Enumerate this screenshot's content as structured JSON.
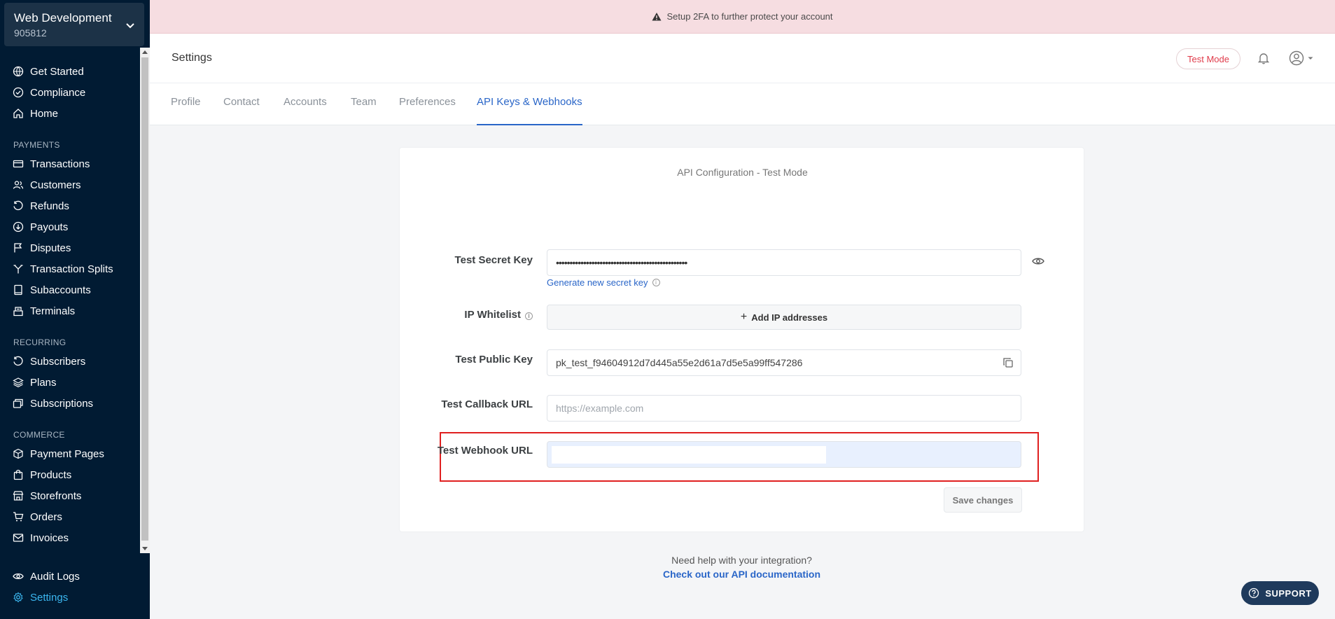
{
  "sidebar": {
    "business_name": "Web Development",
    "business_id": "905812",
    "top_items": [
      {
        "label": "Get Started",
        "icon": "globe-icon"
      },
      {
        "label": "Compliance",
        "icon": "check-circle-icon"
      },
      {
        "label": "Home",
        "icon": "home-icon"
      }
    ],
    "payments_title": "PAYMENTS",
    "payments_items": [
      {
        "label": "Transactions",
        "icon": "card-icon"
      },
      {
        "label": "Customers",
        "icon": "users-icon"
      },
      {
        "label": "Refunds",
        "icon": "refund-icon"
      },
      {
        "label": "Payouts",
        "icon": "payout-icon"
      },
      {
        "label": "Disputes",
        "icon": "flag-icon"
      },
      {
        "label": "Transaction Splits",
        "icon": "split-icon"
      },
      {
        "label": "Subaccounts",
        "icon": "book-icon"
      },
      {
        "label": "Terminals",
        "icon": "terminal-icon"
      }
    ],
    "recurring_title": "RECURRING",
    "recurring_items": [
      {
        "label": "Subscribers",
        "icon": "refresh-icon"
      },
      {
        "label": "Plans",
        "icon": "layers-icon"
      },
      {
        "label": "Subscriptions",
        "icon": "stack-icon"
      }
    ],
    "commerce_title": "COMMERCE",
    "commerce_items": [
      {
        "label": "Payment Pages",
        "icon": "box-icon"
      },
      {
        "label": "Products",
        "icon": "bag-icon"
      },
      {
        "label": "Storefronts",
        "icon": "store-icon"
      },
      {
        "label": "Orders",
        "icon": "cart-icon"
      },
      {
        "label": "Invoices",
        "icon": "mail-icon"
      }
    ],
    "bottom_items": [
      {
        "label": "Audit Logs",
        "icon": "eye-icon"
      },
      {
        "label": "Settings",
        "icon": "gear-icon"
      }
    ],
    "active_color": "#3bb7f0"
  },
  "banner": {
    "text": "Setup 2FA to further protect your account"
  },
  "header": {
    "title": "Settings",
    "test_mode_label": "Test Mode"
  },
  "tabs": [
    {
      "label": "Profile"
    },
    {
      "label": "Contact"
    },
    {
      "label": "Accounts"
    },
    {
      "label": "Team"
    },
    {
      "label": "Preferences"
    },
    {
      "label": "API Keys & Webhooks"
    }
  ],
  "card": {
    "title": "API Configuration - Test Mode",
    "secret_key_label": "Test Secret Key",
    "secret_key_value": "••••••••••••••••••••••••••••••••••••••••••••••••",
    "generate_link": "Generate new secret key",
    "ip_whitelist_label": "IP Whitelist",
    "add_ip_label": "Add IP addresses",
    "public_key_label": "Test Public Key",
    "public_key_value": "pk_test_f94604912d7d445a55e2d61a7d5e5a99ff547286",
    "callback_label": "Test Callback URL",
    "callback_placeholder": "https://example.com",
    "webhook_label": "Test Webhook URL",
    "webhook_value": "",
    "save_label": "Save changes"
  },
  "help": {
    "question": "Need help with your integration?",
    "link": "Check out our API documentation"
  },
  "support_label": "SUPPORT"
}
